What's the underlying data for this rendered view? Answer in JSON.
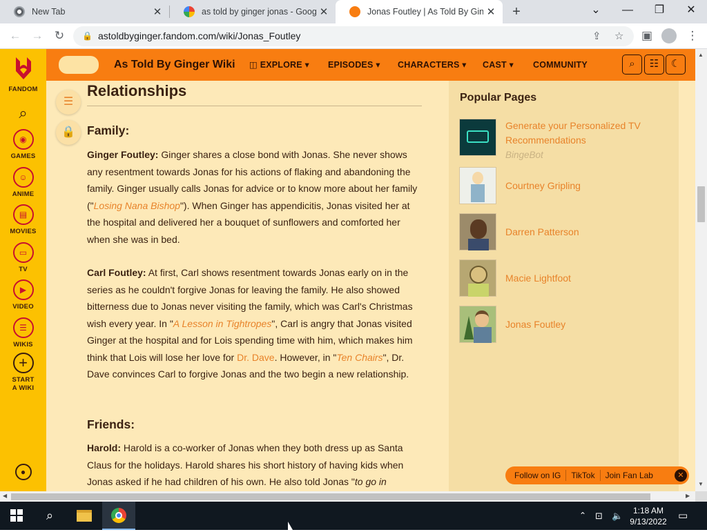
{
  "browser": {
    "tabs": [
      {
        "title": "New Tab",
        "close": "✕"
      },
      {
        "title": "as told by ginger jonas - Google",
        "close": "✕"
      },
      {
        "title": "Jonas Foutley | As Told By Ginger",
        "close": "✕"
      }
    ],
    "new_tab": "+",
    "window_controls": {
      "dropdown": "⌄",
      "minimize": "—",
      "restore": "❐",
      "close": "✕"
    },
    "url": "astoldbyginger.fandom.com/wiki/Jonas_Foutley"
  },
  "rail": {
    "brand": "FANDOM",
    "items": [
      {
        "label": "GAMES",
        "icon": "games-icon"
      },
      {
        "label": "ANIME",
        "icon": "anime-icon"
      },
      {
        "label": "MOVIES",
        "icon": "movies-icon"
      },
      {
        "label": "TV",
        "icon": "tv-icon"
      },
      {
        "label": "VIDEO",
        "icon": "video-icon"
      },
      {
        "label": "WIKIS",
        "icon": "wikis-icon"
      }
    ],
    "start_wiki": "START A WIKI"
  },
  "wiki": {
    "name": "As Told By Ginger Wiki",
    "nav": [
      {
        "label": "EXPLORE"
      },
      {
        "label": "EPISODES"
      },
      {
        "label": "CHARACTERS"
      },
      {
        "label": "CAST"
      },
      {
        "label": "COMMUNITY"
      }
    ]
  },
  "article": {
    "section_title": "Relationships",
    "family_heading": "Family:",
    "ginger": {
      "name": "Ginger Foutley:",
      "text1": " Ginger shares a close bond with Jonas. She never shows any resentment towards Jonas for his actions of flaking and abandoning the family. Ginger usually calls Jonas for advice or to know more about her family (\"",
      "link1": "Losing Nana Bishop",
      "text2": "\"). When Ginger has appendicitis, Jonas visited her at the hospital and delivered her a bouquet of sunflowers and comforted her when she was in bed."
    },
    "carl": {
      "name": "Carl Foutley:",
      "text1": " At first, Carl shows resentment towards Jonas early on in the series as he couldn't forgive Jonas for leaving the family. He also showed bitterness due to Jonas never visiting the family, which was Carl's Christmas wish every year. In \"",
      "link1": "A Lesson in Tightropes",
      "text2": "\", Carl is angry that Jonas visited Ginger at the hospital and for Lois spending time with him, which makes him think that Lois will lose her love for ",
      "link2": "Dr. Dave",
      "text3": ". However, in \"",
      "link3": "Ten Chairs",
      "text4": "\", Dr. Dave convinces Carl to forgive Jonas and the two begin a new relationship."
    },
    "friends_heading": "Friends:",
    "harold": {
      "name": "Harold:",
      "text1": " Harold is a co-worker of Jonas when they both dress up as Santa Claus for the holidays. Harold shares his short history of having kids when Jonas asked if he had children of his own. He also told Jonas \"",
      "italic": "to go in"
    }
  },
  "popular": {
    "title": "Popular Pages",
    "items": [
      {
        "title": "Generate your Personalized TV Recommendations",
        "sub": "BingeBot",
        "thumb_color": "#0b3a3c"
      },
      {
        "title": "Courtney Gripling",
        "sub": "",
        "thumb_color": "#eef0ea"
      },
      {
        "title": "Darren Patterson",
        "sub": "",
        "thumb_color": "#7a5a3a"
      },
      {
        "title": "Macie Lightfoot",
        "sub": "",
        "thumb_color": "#b7a772"
      },
      {
        "title": "Jonas Foutley",
        "sub": "",
        "thumb_color": "#8ca25f"
      }
    ]
  },
  "social": {
    "items": [
      "Follow on IG",
      "TikTok",
      "Join Fan Lab"
    ],
    "close": "✕"
  },
  "taskbar": {
    "time": "1:18 AM",
    "date": "9/13/2022"
  },
  "colors": {
    "fandom_yellow": "#fcc101",
    "wiki_orange": "#f87d11",
    "link_orange": "#e8832a",
    "page_bg": "#fde9b8"
  }
}
